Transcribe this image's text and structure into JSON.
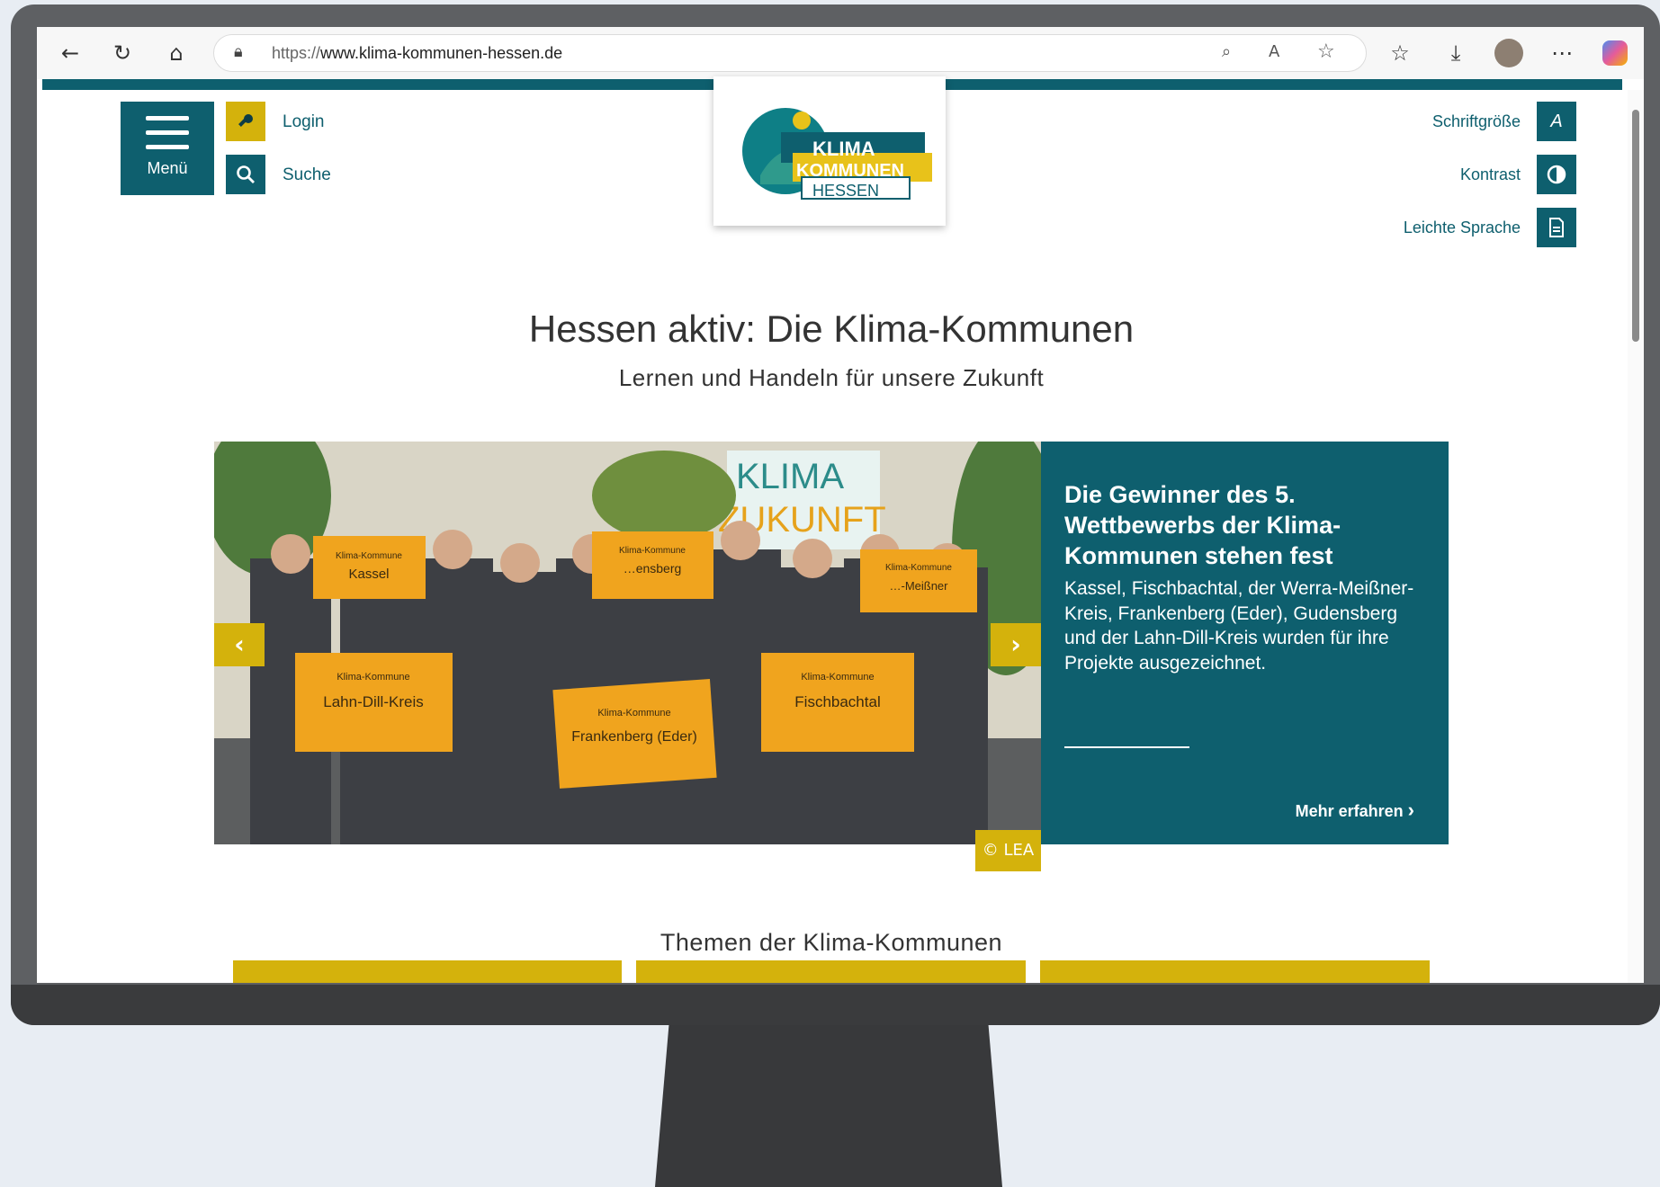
{
  "browser": {
    "url_proto": "https://",
    "url_host": "www.klima-kommunen-hessen.de"
  },
  "header": {
    "menu_label": "Menü",
    "login_label": "Login",
    "search_label": "Suche",
    "font_size_label": "Schriftgröße",
    "contrast_label": "Kontrast",
    "easy_language_label": "Leichte Sprache",
    "logo_line1": "KLIMA",
    "logo_line2": "KOMMUNEN",
    "logo_line3": "HESSEN"
  },
  "main": {
    "headline": "Hessen aktiv: Die Klima-Kommunen",
    "subheadline": "Lernen und Handeln für unsere Zukunft"
  },
  "hero": {
    "title": "Die Gewinner des 5. Wettbewerbs der Klima-Kommunen stehen fest",
    "text": "Kassel, Fischbachtal, der Werra-Meißner-Kreis, Frankenberg (Eder), Gudensberg und der Lahn-Dill-Kreis wurden für ihre Projekte ausgezeichnet.",
    "more_label": "Mehr erfahren",
    "photo_credit": "© LEA",
    "backdrop_line1": "KLIMA",
    "backdrop_line2": "ZUKUNFT",
    "sign_prefix": "Klima-Kommune",
    "signs": [
      "Kassel",
      "…ensberg",
      "…-Meißner",
      "Lahn-Dill-Kreis",
      "Frankenberg (Eder)",
      "Fischbachtal"
    ]
  },
  "themes": {
    "title": "Themen der Klima-Kommunen"
  },
  "colors": {
    "primary_teal": "#0e5f6e",
    "accent_yellow": "#d4b20c"
  }
}
